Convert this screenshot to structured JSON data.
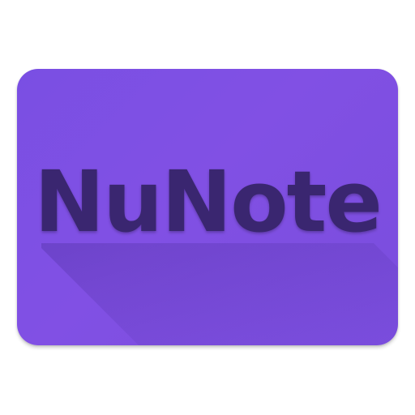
{
  "app": {
    "name": "NuNote"
  },
  "colors": {
    "background": "#7a4fe3",
    "text": "#3a2670",
    "long_shadow": "#5a37b8"
  },
  "icon": {
    "semantic": "app-icon"
  }
}
